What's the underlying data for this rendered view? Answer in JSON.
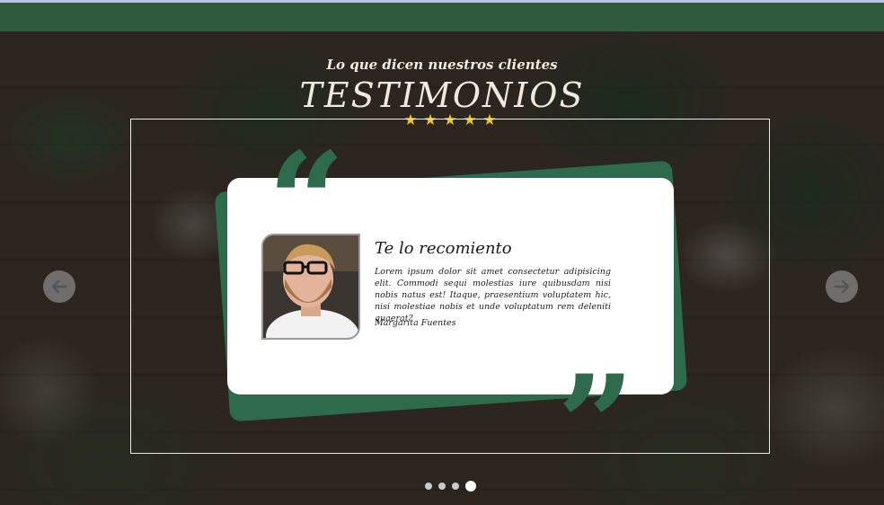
{
  "header": {
    "subtitle": "Lo que dicen nuestros clientes",
    "title": "TESTIMONIOS",
    "rating_stars": 5
  },
  "testimonial": {
    "quote_open": "“",
    "quote_close": "”",
    "title": "Te lo recomiento",
    "body": "Lorem ipsum dolor sit amet consectetur adipisicing elit. Commodi sequi molestias iure quibusdam nisi nobis natus est! Itaque, praesentium voluptatem hic, nisi molestiae nobis et unde voluptatum rem deleniti quaerat?",
    "author": "Margarita Fuentes"
  },
  "carousel": {
    "prev_icon": "arrow-left-icon",
    "next_icon": "arrow-right-icon",
    "slides": 4,
    "active_slide": 4
  },
  "colors": {
    "accent": "#2e6b4c",
    "star": "#f4c91c",
    "navbar": "#2f5a3e"
  }
}
